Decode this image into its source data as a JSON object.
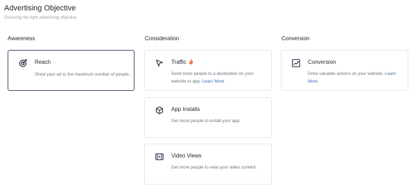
{
  "header": {
    "title": "Advertising Objective",
    "subtitle": "Choosing the right advertising objective"
  },
  "columns": [
    {
      "title": "Awareness",
      "cards": [
        {
          "title": "Reach",
          "description": "Show your ad to the maximum number of people.",
          "icon": "target-icon",
          "selected": true
        }
      ]
    },
    {
      "title": "Consideration",
      "cards": [
        {
          "title": "Traffic",
          "description": "Send more people to a destination on your website or app.",
          "link": "Learn More",
          "icon": "cursor-arrow-icon",
          "badge": "hot-icon"
        },
        {
          "title": "App Installs",
          "description": "Get more people to install your app.",
          "icon": "cube-icon"
        },
        {
          "title": "Video Views",
          "description": "Get more people to view your video content.",
          "icon": "film-icon"
        }
      ]
    },
    {
      "title": "Conversion",
      "cards": [
        {
          "title": "Conversion",
          "description": "Drive valuable actions on your website.",
          "link": "Learn More",
          "icon": "chart-up-icon"
        }
      ]
    }
  ],
  "colors": {
    "selected_border": "#3d4f75",
    "card_border": "#e4e6ea",
    "link": "#3b6fb6",
    "hot_badge": "#f07a3a"
  }
}
